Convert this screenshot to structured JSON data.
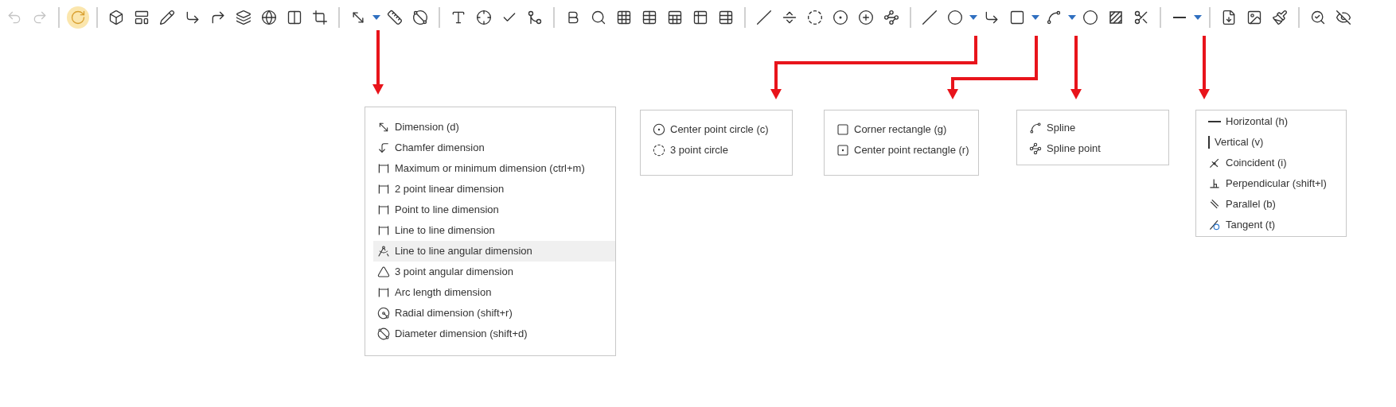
{
  "toolbar": {
    "groups": [
      [
        {
          "disabled": true,
          "active": false,
          "dropdown": false
        },
        {
          "disabled": true,
          "active": false,
          "dropdown": false
        }
      ],
      [
        {
          "disabled": false,
          "active": true,
          "dropdown": false
        }
      ],
      [
        {
          "disabled": false,
          "active": false,
          "dropdown": false
        },
        {
          "disabled": false,
          "active": false,
          "dropdown": false
        },
        {
          "disabled": false,
          "active": false,
          "dropdown": false
        },
        {
          "disabled": false,
          "active": false,
          "dropdown": false
        },
        {
          "disabled": false,
          "active": false,
          "dropdown": false
        },
        {
          "disabled": false,
          "active": false,
          "dropdown": false
        },
        {
          "disabled": false,
          "active": false,
          "dropdown": false
        },
        {
          "disabled": false,
          "active": false,
          "dropdown": false
        },
        {
          "disabled": false,
          "active": false,
          "dropdown": false
        }
      ],
      [
        {
          "disabled": false,
          "active": false,
          "dropdown": true
        },
        {
          "disabled": false,
          "active": false,
          "dropdown": false
        },
        {
          "disabled": false,
          "active": false,
          "dropdown": false
        }
      ],
      [
        {
          "disabled": false,
          "active": false,
          "dropdown": false
        },
        {
          "disabled": false,
          "active": false,
          "dropdown": false
        },
        {
          "disabled": false,
          "active": false,
          "dropdown": false
        },
        {
          "disabled": false,
          "active": false,
          "dropdown": false
        }
      ],
      [
        {
          "disabled": false,
          "active": false,
          "dropdown": false
        },
        {
          "disabled": false,
          "active": false,
          "dropdown": false
        },
        {
          "disabled": false,
          "active": false,
          "dropdown": false
        },
        {
          "disabled": false,
          "active": false,
          "dropdown": false
        },
        {
          "disabled": false,
          "active": false,
          "dropdown": false
        },
        {
          "disabled": false,
          "active": false,
          "dropdown": false
        },
        {
          "disabled": false,
          "active": false,
          "dropdown": false
        }
      ],
      [
        {
          "disabled": false,
          "active": false,
          "dropdown": false
        },
        {
          "disabled": false,
          "active": false,
          "dropdown": false
        },
        {
          "disabled": false,
          "active": false,
          "dropdown": false
        },
        {
          "disabled": false,
          "active": false,
          "dropdown": false
        },
        {
          "disabled": false,
          "active": false,
          "dropdown": false
        },
        {
          "disabled": false,
          "active": false,
          "dropdown": false
        }
      ],
      [
        {
          "disabled": false,
          "active": false,
          "dropdown": false
        },
        {
          "disabled": false,
          "active": false,
          "dropdown": true
        },
        {
          "disabled": false,
          "active": false,
          "dropdown": false
        },
        {
          "disabled": false,
          "active": false,
          "dropdown": true
        },
        {
          "disabled": false,
          "active": false,
          "dropdown": true
        },
        {
          "disabled": false,
          "active": false,
          "dropdown": false
        },
        {
          "disabled": false,
          "active": false,
          "dropdown": false
        },
        {
          "disabled": false,
          "active": false,
          "dropdown": false
        }
      ],
      [
        {
          "disabled": false,
          "active": false,
          "dropdown": true
        }
      ],
      [
        {
          "disabled": false,
          "active": false,
          "dropdown": false
        },
        {
          "disabled": false,
          "active": false,
          "dropdown": false
        },
        {
          "disabled": false,
          "active": false,
          "dropdown": false
        }
      ],
      [
        {
          "disabled": false,
          "active": false,
          "dropdown": false
        },
        {
          "disabled": false,
          "active": false,
          "dropdown": false
        }
      ]
    ]
  },
  "menus": [
    {
      "items": [
        {
          "label": "Dimension (d)",
          "highlighted": false
        },
        {
          "label": "Chamfer dimension",
          "highlighted": false
        },
        {
          "label": "Maximum or minimum dimension (ctrl+m)",
          "highlighted": false
        },
        {
          "label": "2 point linear dimension",
          "highlighted": false
        },
        {
          "label": "Point to line dimension",
          "highlighted": false
        },
        {
          "label": "Line to line dimension",
          "highlighted": false
        },
        {
          "label": "Line to line angular dimension",
          "highlighted": true
        },
        {
          "label": "3 point angular dimension",
          "highlighted": false
        },
        {
          "label": "Arc length dimension",
          "highlighted": false
        },
        {
          "label": "Radial dimension (shift+r)",
          "highlighted": false
        },
        {
          "label": "Diameter dimension (shift+d)",
          "highlighted": false
        }
      ]
    },
    {
      "items": [
        {
          "label": "Center point circle (c)",
          "highlighted": false
        },
        {
          "label": "3 point circle",
          "highlighted": false
        }
      ]
    },
    {
      "items": [
        {
          "label": "Corner rectangle (g)",
          "highlighted": false
        },
        {
          "label": "Center point rectangle (r)",
          "highlighted": false
        }
      ]
    },
    {
      "items": [
        {
          "label": "Spline",
          "highlighted": false
        },
        {
          "label": "Spline point",
          "highlighted": false
        }
      ]
    },
    {
      "items": [
        {
          "label": "Horizontal (h)",
          "highlighted": false
        },
        {
          "label": "Vertical (v)",
          "highlighted": false
        },
        {
          "label": "Coincident (i)",
          "highlighted": false
        },
        {
          "label": "Perpendicular (shift+l)",
          "highlighted": false
        },
        {
          "label": "Parallel (b)",
          "highlighted": false
        },
        {
          "label": "Tangent (t)",
          "highlighted": false
        }
      ]
    }
  ]
}
